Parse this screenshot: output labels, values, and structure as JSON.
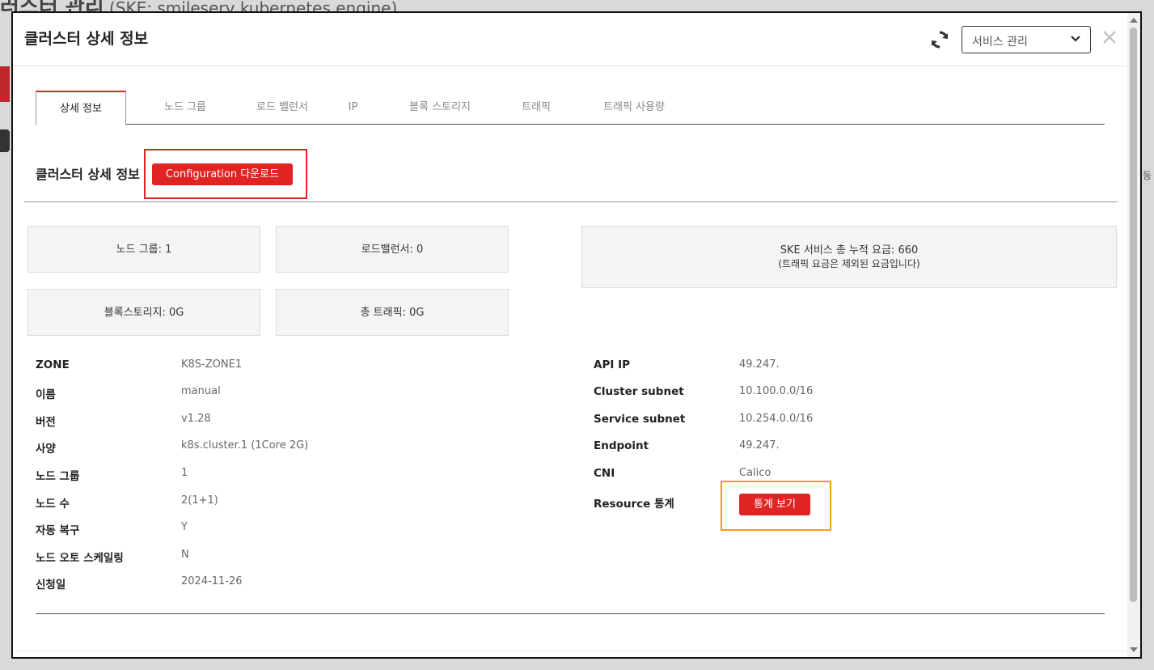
{
  "background": {
    "title_prefix": "러스터 관리",
    "title_suffix": "(SKE: smileserv kubernetes engine)",
    "right_text": "동"
  },
  "modal": {
    "title": "클러스터 상세 정보",
    "service_select": {
      "selected": "서비스 관리"
    }
  },
  "tabs": [
    {
      "label": "상세 정보",
      "active": true
    },
    {
      "label": "노드 그룹",
      "active": false
    },
    {
      "label": "로드 밸런서",
      "active": false
    },
    {
      "label": "IP",
      "active": false
    },
    {
      "label": "블록 스토리지",
      "active": false
    },
    {
      "label": "트래픽",
      "active": false
    },
    {
      "label": "트래픽 사용량",
      "active": false
    }
  ],
  "section": {
    "title": "클러스터 상세 정보",
    "config_button": "Configuration 다운로드"
  },
  "summary": {
    "node_group": "노드 그룹: 1",
    "load_balancer": "로드밸런서: 0",
    "block_storage": "블록스토리지: 0G",
    "total_traffic": "총 트래픽: 0G",
    "fee_line1": "SKE 서비스 총 누적 요금: 660",
    "fee_line2": "(트래픽 요금은 제외된 요금입니다)"
  },
  "details_left": [
    {
      "label": "ZONE",
      "value": "K8S-ZONE1"
    },
    {
      "label": "이름",
      "value": "manual"
    },
    {
      "label": "버전",
      "value": "v1.28"
    },
    {
      "label": "사양",
      "value": "k8s.cluster.1 (1Core 2G)"
    },
    {
      "label": "노드 그룹",
      "value": "1"
    },
    {
      "label": "노드 수",
      "value": "2(1+1)"
    },
    {
      "label": "자동 복구",
      "value": "Y"
    },
    {
      "label": "노드 오토 스케일링",
      "value": "N"
    },
    {
      "label": "신청일",
      "value": "2024-11-26"
    }
  ],
  "details_right": [
    {
      "label": "API IP",
      "value": "49.247."
    },
    {
      "label": "Cluster subnet",
      "value": "10.100.0.0/16"
    },
    {
      "label": "Service subnet",
      "value": "10.254.0.0/16"
    },
    {
      "label": "Endpoint",
      "value": "49.247."
    },
    {
      "label": "CNI",
      "value": "Calico"
    },
    {
      "label": "Resource 통계",
      "value": ""
    }
  ],
  "stats_button": "통계 보기",
  "colors": {
    "accent_red": "#e02424",
    "highlight_orange": "#f39c12"
  }
}
